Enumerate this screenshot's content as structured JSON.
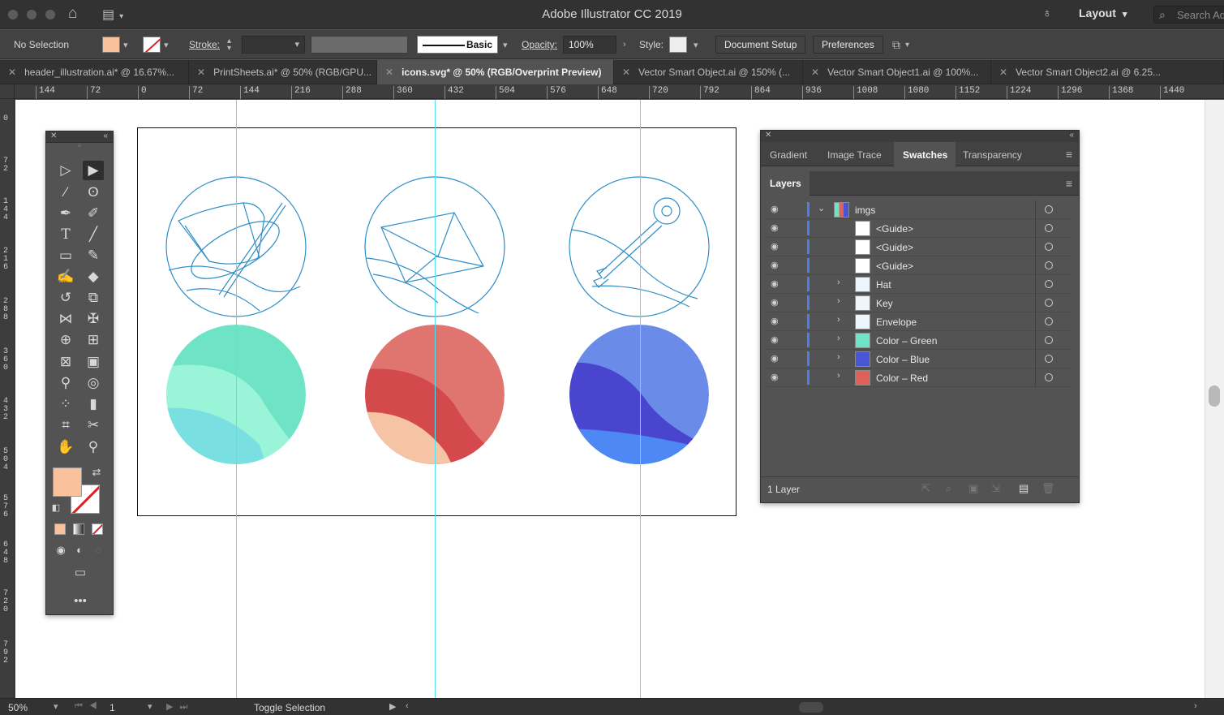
{
  "app": {
    "title": "Adobe Illustrator CC 2019",
    "workspace": "Layout",
    "search_placeholder": "Search Ad"
  },
  "control_bar": {
    "selection": "No Selection",
    "stroke_label": "Stroke:",
    "brush_label": "Basic",
    "opacity_label": "Opacity:",
    "opacity_value": "100%",
    "style_label": "Style:",
    "document_setup": "Document Setup",
    "preferences": "Preferences",
    "fill_color": "#f9c19c"
  },
  "tabs": [
    {
      "label": "header_illustration.ai* @ 16.67%..."
    },
    {
      "label": "PrintSheets.ai* @ 50% (RGB/GPU..."
    },
    {
      "label": "icons.svg* @ 50% (RGB/Overprint Preview)",
      "active": true
    },
    {
      "label": "Vector Smart Object.ai @ 150% (..."
    },
    {
      "label": "Vector Smart Object1.ai @ 100%..."
    },
    {
      "label": "Vector Smart Object2.ai @ 6.25..."
    }
  ],
  "hruler": [
    "144",
    "72",
    "0",
    "72",
    "144",
    "216",
    "288",
    "360",
    "432",
    "504",
    "576",
    "648",
    "720",
    "792",
    "864",
    "936",
    "1008",
    "1080",
    "1152",
    "1224",
    "1296",
    "1368",
    "1440"
  ],
  "vruler": [
    "0",
    "72",
    "144",
    "216",
    "288",
    "360",
    "432",
    "504",
    "576",
    "648",
    "720",
    "792"
  ],
  "panels": {
    "tabs": [
      "Gradient",
      "Image Trace",
      "Swatches",
      "Transparency"
    ],
    "active_tab": "Swatches",
    "layers_title": "Layers",
    "layers": [
      {
        "name": "imgs",
        "type": "layer",
        "expanded": true
      },
      {
        "name": "<Guide>",
        "type": "guide"
      },
      {
        "name": "<Guide>",
        "type": "guide"
      },
      {
        "name": "<Guide>",
        "type": "guide"
      },
      {
        "name": "Hat",
        "type": "group"
      },
      {
        "name": "Key",
        "type": "group"
      },
      {
        "name": "Envelope",
        "type": "group"
      },
      {
        "name": "Color – Green",
        "type": "group",
        "color": "#6fe3c5"
      },
      {
        "name": "Color – Blue",
        "type": "group",
        "color": "#4a55d6"
      },
      {
        "name": "Color – Red",
        "type": "group",
        "color": "#e0605a"
      }
    ],
    "layer_count": "1 Layer"
  },
  "status_bar": {
    "zoom": "50%",
    "page": "1",
    "mode": "Toggle Selection"
  },
  "colors": {
    "guide": "#4fe3f0",
    "line_art": "#2f8ec7",
    "layer_bar": "#4c7de8"
  }
}
